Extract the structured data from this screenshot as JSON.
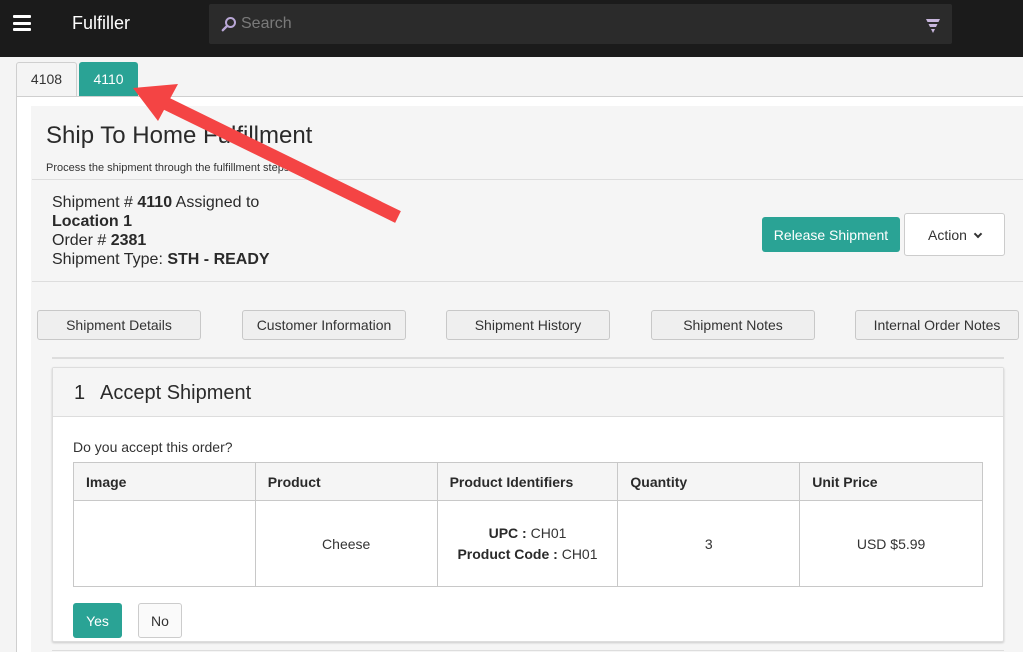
{
  "header": {
    "app_title": "Fulfiller",
    "search_placeholder": "Search",
    "icons": {
      "menu": "hamburger-menu-icon",
      "search": "search-icon",
      "filter": "filter-funnel-icon"
    }
  },
  "tabs": [
    {
      "label": "4108",
      "active": false
    },
    {
      "label": "4110",
      "active": true
    }
  ],
  "page": {
    "title": "Ship To Home Fulfillment",
    "subtitle": "Process the shipment through the fulfillment steps."
  },
  "shipment": {
    "shipment_label": "Shipment #",
    "shipment_number": "4110",
    "assigned_label": "Assigned to",
    "location": "Location 1",
    "order_label": "Order #",
    "order_number": "2381",
    "type_label": "Shipment Type:",
    "type_value": "STH - READY"
  },
  "actions": {
    "release_label": "Release Shipment",
    "action_label": "Action"
  },
  "section_buttons": [
    "Shipment Details",
    "Customer Information",
    "Shipment History",
    "Shipment Notes",
    "Internal Order Notes"
  ],
  "step": {
    "number": "1",
    "title": "Accept Shipment",
    "question": "Do you accept this order?",
    "columns": [
      "Image",
      "Product",
      "Product Identifiers",
      "Quantity",
      "Unit Price"
    ],
    "rows": [
      {
        "image": "",
        "product": "Cheese",
        "upc_label": "UPC :",
        "upc": "CH01",
        "code_label": "Product Code :",
        "code": "CH01",
        "quantity": "3",
        "unit_price": "USD $5.99"
      }
    ],
    "yes_label": "Yes",
    "no_label": "No"
  },
  "annotation": {
    "type": "arrow",
    "color": "#f44040",
    "points_to": "tab 4110"
  }
}
